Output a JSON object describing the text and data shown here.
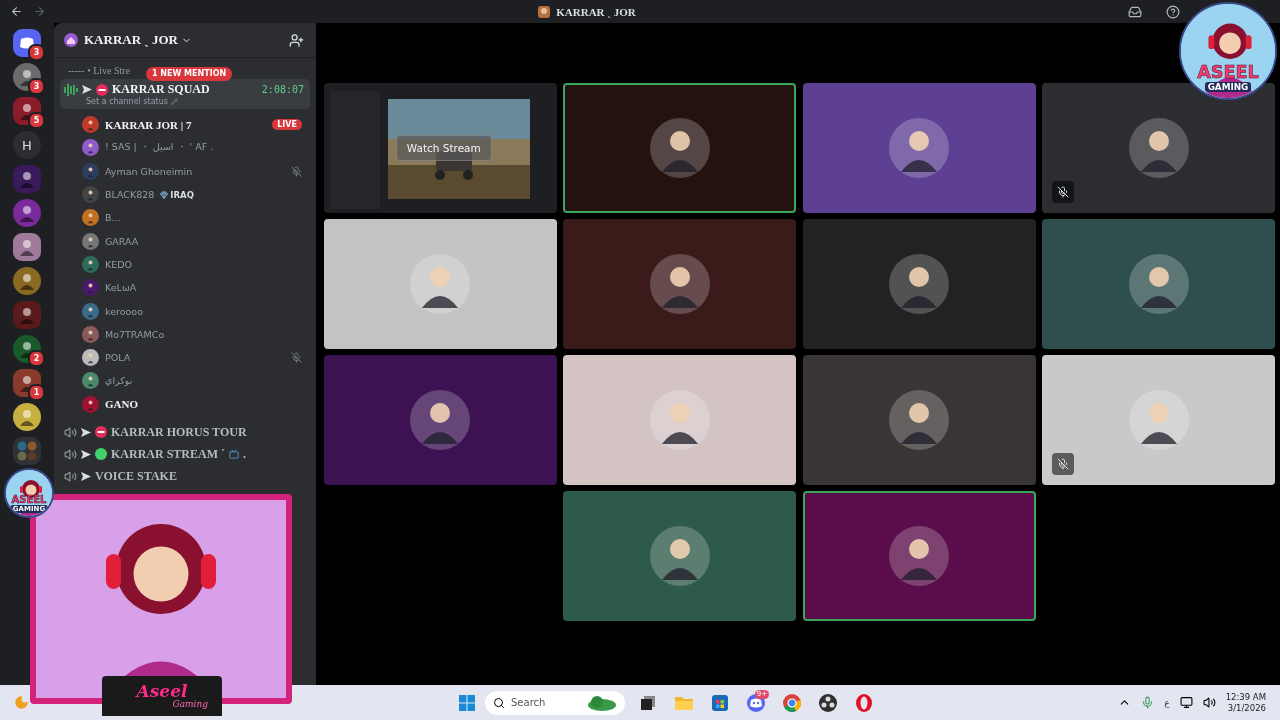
{
  "titlebar": {
    "title": "KARRAR ˎ JOR"
  },
  "servers": [
    {
      "kind": "home",
      "badge": "3",
      "color": "#5865f2"
    },
    {
      "kind": "avatar",
      "badge": "3",
      "color": "#6b6b6b"
    },
    {
      "kind": "avatar",
      "badge": "5",
      "color": "#8b1d2a"
    },
    {
      "kind": "letter",
      "label": "H",
      "color": "#2b2d31"
    },
    {
      "kind": "avatar",
      "color": "#3a1a5a"
    },
    {
      "kind": "avatar",
      "color": "#7a2a9a"
    },
    {
      "kind": "avatar",
      "color": "#a07a9a"
    },
    {
      "kind": "avatar",
      "color": "#8a6a20"
    },
    {
      "kind": "avatar",
      "color": "#5a1a1a"
    },
    {
      "kind": "avatar",
      "badge": "2",
      "color": "#1a5a2a"
    },
    {
      "kind": "avatar",
      "badge": "1",
      "color": "#8a3a2a"
    },
    {
      "kind": "avatar",
      "color": "#c8b040"
    },
    {
      "kind": "folder",
      "color": "#2f3136"
    }
  ],
  "sidebar": {
    "server_name": "KARRAR ˎ JOR",
    "category": "----- • Live Stre",
    "mention": "1 NEW MENTION",
    "voice_channels": [
      {
        "name": "KARRAR SQUAD",
        "kind": "no-entry",
        "selected": true,
        "timer": "2:08:07",
        "status": "Set a channel status",
        "members": [
          {
            "name": "KARRAR JOR | 7",
            "color": "#c0392b",
            "bright": true,
            "live": "LIVE",
            "muted": false
          },
          {
            "name": "! SAS | ・ اسيل ・ ' AF .",
            "color": "#8e5bc8",
            "bright": false,
            "muted": false
          },
          {
            "name": "Ayman Ghoneimin",
            "color": "#2c3e60",
            "bright": false,
            "muted": true
          },
          {
            "name": "BLACK828",
            "tag": "IRAQ",
            "color": "#444444",
            "bright": false,
            "muted": false
          },
          {
            "name": "B...",
            "color": "#c07020",
            "bright": false,
            "muted": false
          },
          {
            "name": "GARAA",
            "color": "#777777",
            "bright": false,
            "muted": false
          },
          {
            "name": "KEDO",
            "color": "#2e6b5a",
            "bright": false,
            "muted": false
          },
          {
            "name": "KeLωA",
            "color": "#4a1a6a",
            "bright": false,
            "muted": false
          },
          {
            "name": "keroooo",
            "color": "#3a6a8a",
            "bright": false,
            "muted": false
          },
          {
            "name": "Mo7TRAMCo",
            "color": "#8a5a5a",
            "bright": false,
            "muted": false
          },
          {
            "name": "POLA",
            "color": "#bbbbbb",
            "bright": false,
            "muted": true
          },
          {
            "name": "نوكراي",
            "color": "#4a8a6a",
            "bright": false,
            "muted": false
          },
          {
            "name": "GANO",
            "color": "#a01030",
            "bright": true,
            "muted": false
          }
        ]
      },
      {
        "name": "KARRAR HORUS TOUR",
        "kind": "no-entry",
        "selected": false
      },
      {
        "name": "KARRAR STREAM ´",
        "kind": "circle",
        "tv": true,
        "suffix": ".",
        "selected": false
      },
      {
        "name": "VOICE STAKE",
        "kind": "none",
        "selected": false
      }
    ]
  },
  "tiles": [
    {
      "kind": "stream",
      "label": "Watch Stream",
      "color": "#1e1f22",
      "speaking": false,
      "muted": false
    },
    {
      "kind": "avatar",
      "color": "#241210",
      "speaking": true,
      "muted": false
    },
    {
      "kind": "avatar",
      "color": "#5d3f93",
      "speaking": false,
      "muted": false
    },
    {
      "kind": "avatar",
      "color": "#2b2d31",
      "speaking": false,
      "muted": true
    },
    {
      "kind": "avatar",
      "color": "#c4c4c4",
      "speaking": false,
      "muted": false
    },
    {
      "kind": "avatar",
      "color": "#3b1a1a",
      "speaking": false,
      "muted": false
    },
    {
      "kind": "avatar",
      "color": "#222222",
      "speaking": false,
      "muted": false
    },
    {
      "kind": "avatar",
      "color": "#2f4f4f",
      "speaking": false,
      "muted": false
    },
    {
      "kind": "avatar",
      "color": "#3c1253",
      "speaking": false,
      "muted": false
    },
    {
      "kind": "avatar",
      "color": "#d3c3c3",
      "speaking": false,
      "muted": false
    },
    {
      "kind": "avatar",
      "color": "#3a3535",
      "speaking": false,
      "muted": false
    },
    {
      "kind": "avatar",
      "color": "#c9c9c9",
      "speaking": false,
      "muted": true
    },
    {
      "kind": "avatar",
      "color": "#2e5a4a",
      "speaking": false,
      "muted": false
    },
    {
      "kind": "avatar",
      "color": "#5a0d4a",
      "speaking": true,
      "muted": false
    }
  ],
  "overlay": {
    "logo": [
      "ASEEL",
      "GAMING"
    ],
    "cam_logo": [
      "ASEEL",
      "GAMING"
    ],
    "caption": [
      "Aseel",
      "Gaming"
    ]
  },
  "taskbar": {
    "search": "Search",
    "discord_badge": "9+",
    "language": "ع",
    "time": "12:39 AM",
    "date": "3/1/2026"
  }
}
